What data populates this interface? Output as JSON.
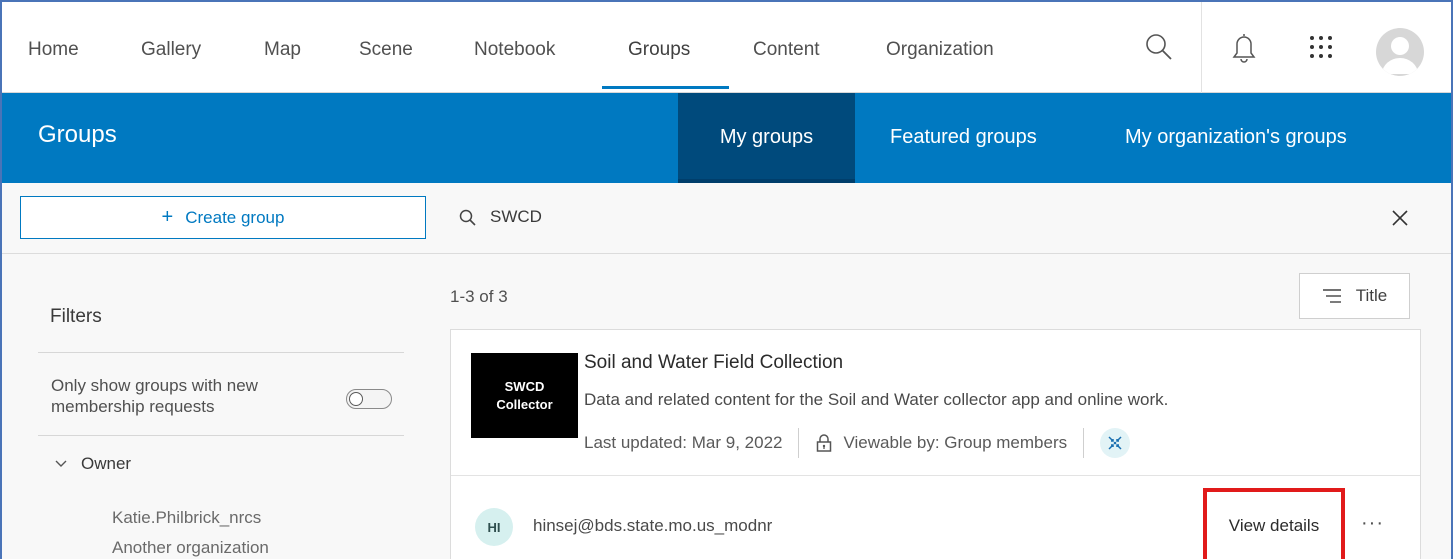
{
  "topnav": {
    "items": [
      {
        "label": "Home"
      },
      {
        "label": "Gallery"
      },
      {
        "label": "Map"
      },
      {
        "label": "Scene"
      },
      {
        "label": "Notebook"
      },
      {
        "label": "Groups"
      },
      {
        "label": "Content"
      },
      {
        "label": "Organization"
      }
    ],
    "active": "Groups",
    "icons": [
      "search-icon",
      "bell-icon",
      "app-launcher-icon",
      "user-avatar"
    ]
  },
  "header": {
    "title": "Groups",
    "tabs": [
      {
        "label": "My groups",
        "active": true
      },
      {
        "label": "Featured groups",
        "active": false
      },
      {
        "label": "My organization's groups",
        "active": false
      }
    ]
  },
  "toolbar": {
    "create_plus": "+",
    "create_label": "Create group",
    "search_value": "SWCD"
  },
  "filters": {
    "title": "Filters",
    "toggle_label": "Only show groups with new membership requests",
    "toggle_on": false,
    "owner_heading": "Owner",
    "owner_items": [
      "Katie.Philbrick_nrcs",
      "Another organization"
    ]
  },
  "results": {
    "count": "1-3 of 3",
    "sort_label": "Title",
    "card": {
      "thumb_line1": "SWCD",
      "thumb_line2": "Collector",
      "title": "Soil and Water Field Collection",
      "description": "Data and related content for the Soil and Water collector app and online work.",
      "updated": "Last updated: Mar 9, 2022",
      "viewable": "Viewable by: Group members",
      "member_initials": "HI",
      "member_name": "hinsej@bds.state.mo.us_modnr",
      "view_details": "View details",
      "more": "···"
    }
  },
  "colors": {
    "brand_blue": "#0079c1",
    "active_tab": "#004a7c",
    "highlight_red": "#e11a1a"
  }
}
